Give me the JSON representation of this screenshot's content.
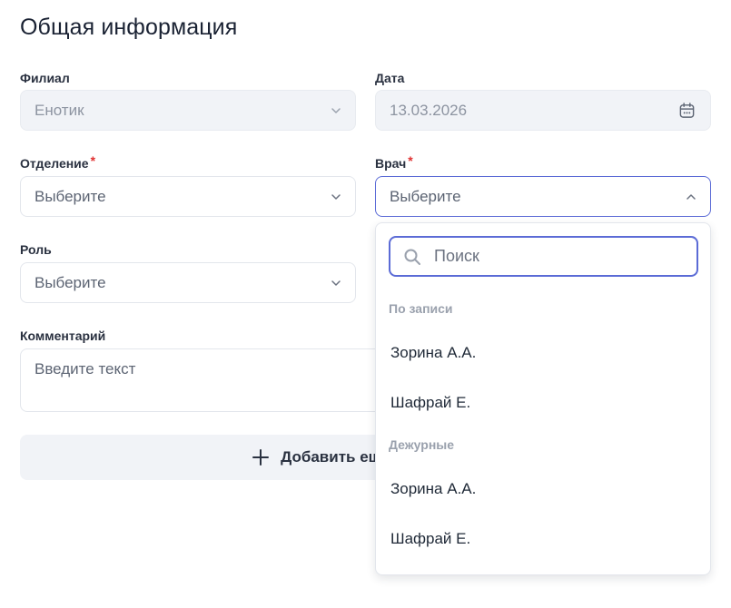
{
  "section": {
    "title": "Общая информация"
  },
  "fields": {
    "branch": {
      "label": "Филиал",
      "value": "Енотик"
    },
    "date": {
      "label": "Дата",
      "value": "13.03.2026"
    },
    "department": {
      "label": "Отделение",
      "required_mark": "*",
      "placeholder": "Выберите"
    },
    "doctor": {
      "label": "Врач",
      "required_mark": "*",
      "placeholder": "Выберите"
    },
    "role": {
      "label": "Роль",
      "placeholder": "Выберите"
    },
    "comment": {
      "label": "Комментарий",
      "placeholder": "Введите текст"
    }
  },
  "add_button": {
    "label": "Добавить ещ"
  },
  "dropdown": {
    "search_placeholder": "Поиск",
    "groups": [
      {
        "label": "По записи",
        "options": [
          "Зорина А.А.",
          "Шафрай Е."
        ]
      },
      {
        "label": "Дежурные",
        "options": [
          "Зорина А.А.",
          "Шафрай Е."
        ]
      }
    ]
  },
  "colors": {
    "accent": "#5b6bd6",
    "required": "#e03131",
    "disabled_bg": "#f1f3f7"
  },
  "icons": {
    "chevron": "chevron-down-icon",
    "calendar": "calendar-icon",
    "search": "search-icon",
    "plus": "plus-icon"
  }
}
